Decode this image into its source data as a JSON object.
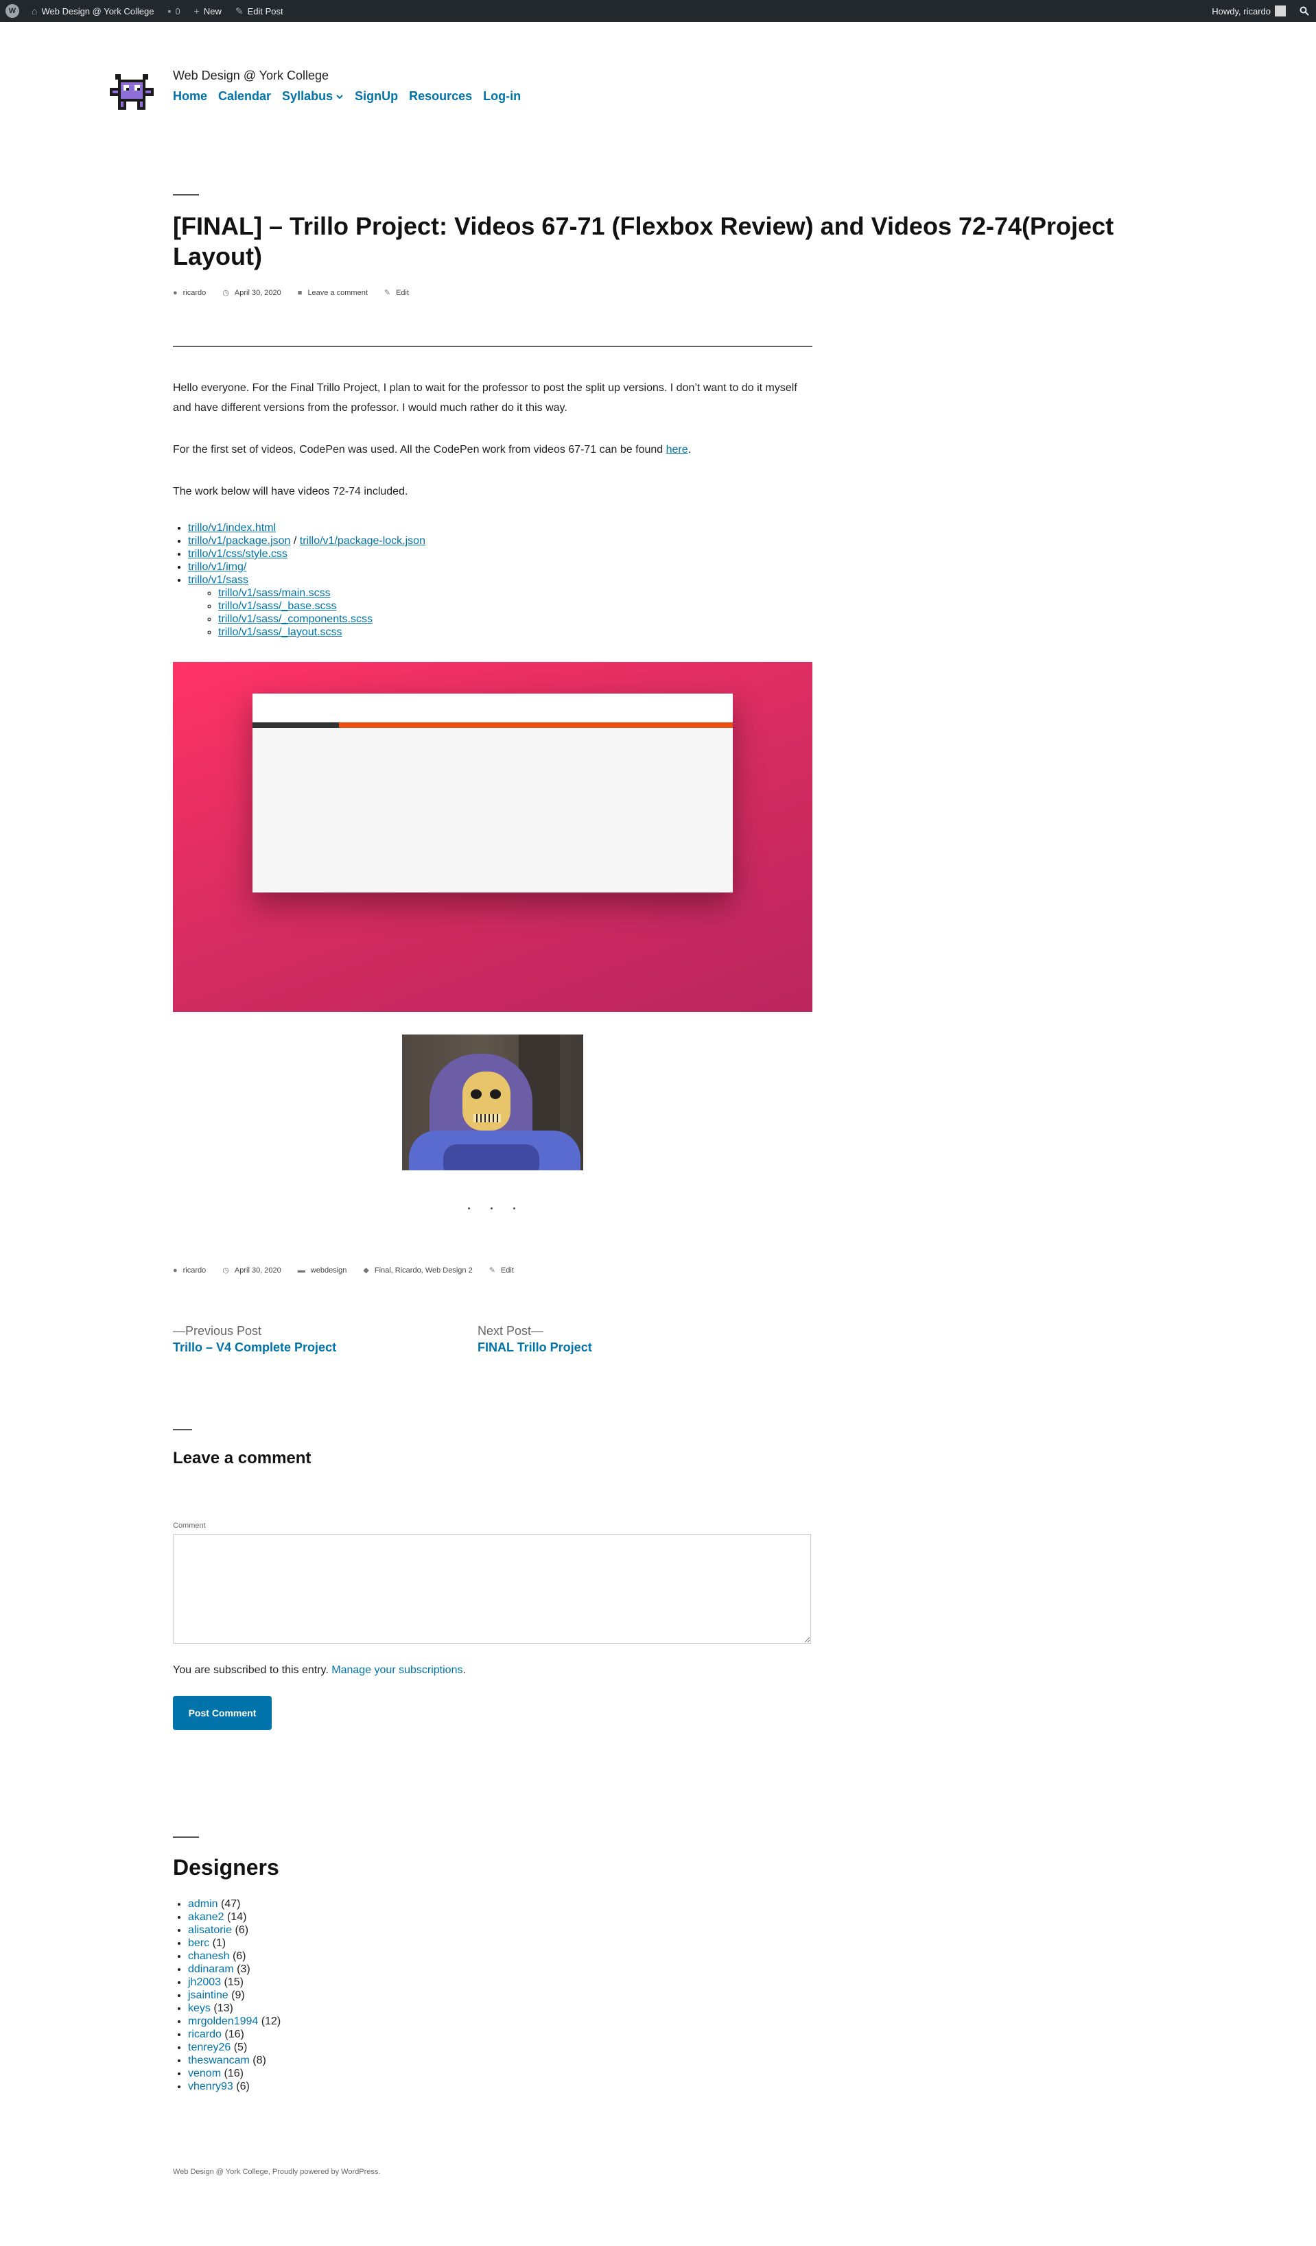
{
  "adminbar": {
    "site_name": "Web Design @ York College",
    "comments_count": "0",
    "new_label": "New",
    "edit_post_label": "Edit Post",
    "howdy": "Howdy, ricardo"
  },
  "header": {
    "site_title": "Web Design @ York College",
    "nav": [
      "Home",
      "Calendar",
      "Syllabus",
      "SignUp",
      "Resources",
      "Log-in"
    ]
  },
  "post": {
    "title": "[FINAL] – Trillo Project: Videos 67-71 (Flexbox Review) and Videos 72-74(Project Layout)",
    "meta": {
      "author": "ricardo",
      "date": "April 30, 2020",
      "comment_link": "Leave a comment",
      "edit": "Edit"
    },
    "paragraphs": {
      "p1": "Hello everyone. For the Final Trillo Project, I plan to wait for the professor to post the split up versions. I don’t want to do it myself and have different versions from the professor. I would much rather do it this way.",
      "p2_text": "For the first set of videos, CodePen was used. All the CodePen work from videos 67-71 can be found ",
      "p2_link": "here",
      "p2_end": ".",
      "p3": "The work below will have videos 72-74 included."
    },
    "files": {
      "index": "trillo/v1/index.html",
      "package": "trillo/v1/package.json",
      "separator": " / ",
      "package_lock": "trillo/v1/package-lock.json",
      "style": "trillo/v1/css/style.css",
      "img": "trillo/v1/img/",
      "sass": "trillo/v1/sass",
      "sass_children": [
        "trillo/v1/sass/main.scss",
        "trillo/v1/sass/_base.scss",
        "trillo/v1/sass/_components.scss",
        "trillo/v1/sass/_layout.scss"
      ]
    },
    "footer_meta": {
      "author": "ricardo",
      "date": "April 30, 2020",
      "category": "webdesign",
      "tags": "Final, Ricardo, Web Design 2",
      "edit": "Edit"
    }
  },
  "post_nav": {
    "prev_label": "—Previous Post",
    "prev_title": "Trillo – V4 Complete Project",
    "next_label": "Next Post—",
    "next_title": "FINAL Trillo Project"
  },
  "comments": {
    "heading": "Leave a comment",
    "field_label": "Comment",
    "subscribed_text": "You are subscribed to this entry. ",
    "manage_link": "Manage your subscriptions",
    "manage_end": ".",
    "submit_label": "Post Comment"
  },
  "designers": {
    "heading": "Designers",
    "items": [
      {
        "name": "admin",
        "count": "(47)"
      },
      {
        "name": "akane2",
        "count": "(14)"
      },
      {
        "name": "alisatorie",
        "count": "(6)"
      },
      {
        "name": "berc",
        "count": "(1)"
      },
      {
        "name": "chanesh",
        "count": "(6)"
      },
      {
        "name": "ddinaram",
        "count": "(3)"
      },
      {
        "name": "jh2003",
        "count": "(15)"
      },
      {
        "name": "jsaintine",
        "count": "(9)"
      },
      {
        "name": "keys",
        "count": "(13)"
      },
      {
        "name": "mrgolden1994",
        "count": "(12)"
      },
      {
        "name": "ricardo",
        "count": "(16)"
      },
      {
        "name": "tenrey26",
        "count": "(5)"
      },
      {
        "name": "theswancam",
        "count": "(8)"
      },
      {
        "name": "venom",
        "count": "(16)"
      },
      {
        "name": "vhenry93",
        "count": "(6)"
      }
    ]
  },
  "footer": {
    "text": "Web Design @ York College, Proudly powered by WordPress."
  },
  "colors": {
    "link": "#0073aa",
    "adminbar_bg": "#23282d",
    "preview_gradient_start": "#ff3366",
    "preview_gradient_end": "#ba265d",
    "preview_orange": "#ee4e12"
  },
  "icons": {
    "wordpress": "wordpress-logo-icon",
    "site": "home-icon",
    "comments": "comment-bubble-icon",
    "new": "plus-icon",
    "edit": "pencil-icon",
    "search": "search-icon",
    "author": "person-icon",
    "date": "clock-icon",
    "category": "folder-icon",
    "tag": "tag-icon",
    "submenu": "chevron-down-icon"
  }
}
